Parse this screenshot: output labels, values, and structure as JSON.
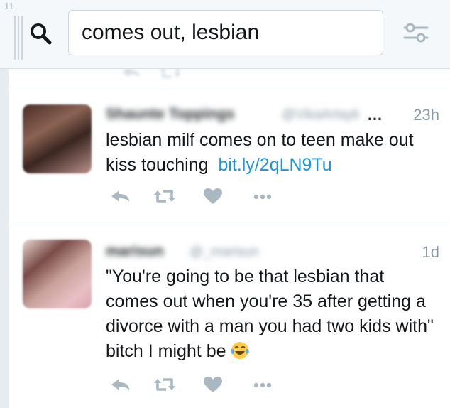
{
  "column": {
    "number": "11"
  },
  "search": {
    "query": "comes out, lesbian"
  },
  "tweets": [
    {
      "user_name": "Shaunte Toppings",
      "user_handle": "@VikaArtayk",
      "truncation": "…",
      "time": "23h",
      "text": "lesbian milf comes on to teen make out kiss touching",
      "link": "bit.ly/2qLN9Tu"
    },
    {
      "user_name": "marisun",
      "user_handle": "@_marisun",
      "time": "1d",
      "text": "\"You're going to be that lesbian that comes out when you're 35 after getting a divorce with a man you had two kids with\" bitch I might be"
    }
  ],
  "icons": [
    "reply-icon",
    "retweet-icon",
    "like-icon",
    "more-icon",
    "search-icon",
    "filter-icon",
    "drag-handle",
    "tears-of-joy-emoji"
  ],
  "colors": {
    "link": "#1b95e0",
    "icon": "#aab8c2",
    "text": "#14171a",
    "muted": "#8899a6"
  }
}
